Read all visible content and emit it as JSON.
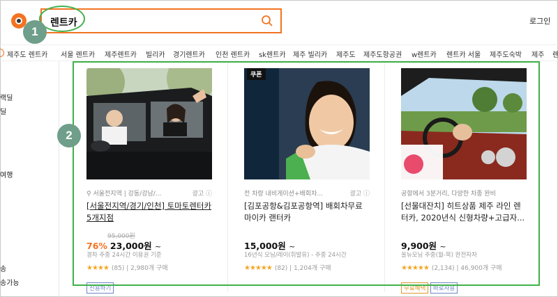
{
  "header": {
    "search_value": "렌트카",
    "login_label": "로그인"
  },
  "annotations": {
    "badge1": "1",
    "badge2": "2"
  },
  "keywords": [
    "제주도 렌트카",
    "서울 렌트카",
    "제주렌트카",
    "빌리카",
    "경기렌트카",
    "인천 렌트카",
    "sk렌트카",
    "제주 빌리카",
    "제주도",
    "제주도항공권",
    "w렌트카",
    "렌트카 서울",
    "제주도숙박",
    "제주",
    "렌"
  ],
  "sidebar": [
    "랙딜",
    "딜",
    "여행",
    "송",
    "송가능"
  ],
  "products": [
    {
      "meta": "서울전지역 | 강동/강남/...",
      "ad": "광고 ⓘ",
      "title": "[서울전지역/경기/인천] 토마토렌터카 5개지점",
      "orig_price": "95,000원",
      "discount": "76%",
      "price": "23,000원",
      "tilde": "~",
      "sub": "경차 주중 24시간 이용권 기준",
      "stars": "★★★★",
      "reviews": "(85)",
      "sold": "2,980개 구매",
      "tags": [
        {
          "label": "신용하기",
          "color": "#6b86c6"
        }
      ]
    },
    {
      "meta": "전 차량 내비게이션+배회차...",
      "ad": "광고 ⓘ",
      "title": "[김포공항&김포공항역] 배회차무료 마이카 랜터카",
      "price": "15,000원",
      "tilde": "~",
      "sub": "16년식 모닝/레이(휘발유) - 주중 24시간",
      "stars": "★★★★★",
      "reviews": "(82)",
      "sold": "1,204개 구매",
      "coupon": "쿠폰",
      "tags": []
    },
    {
      "meta": "공항에서 3분거리, 다양한 차종 완비",
      "title": "[선물대잔치] 히트상품 제주 라인 렌터카, 2020년식 신형차량+고급자...",
      "price": "9,900원",
      "tilde": "~",
      "sub": "올뉴모닝 주중(월-목) 완전자차",
      "stars": "★★★★★",
      "reviews": "(2,134)",
      "sold": "46,900개 구매",
      "tags": [
        {
          "label": "무료혜택",
          "color": "#e0962a"
        },
        {
          "label": "바로사용",
          "color": "#6b86c6"
        }
      ]
    }
  ],
  "colors": {
    "accent": "#f37321",
    "highlight": "#3fb14a",
    "badge": "#6f9e8b"
  }
}
